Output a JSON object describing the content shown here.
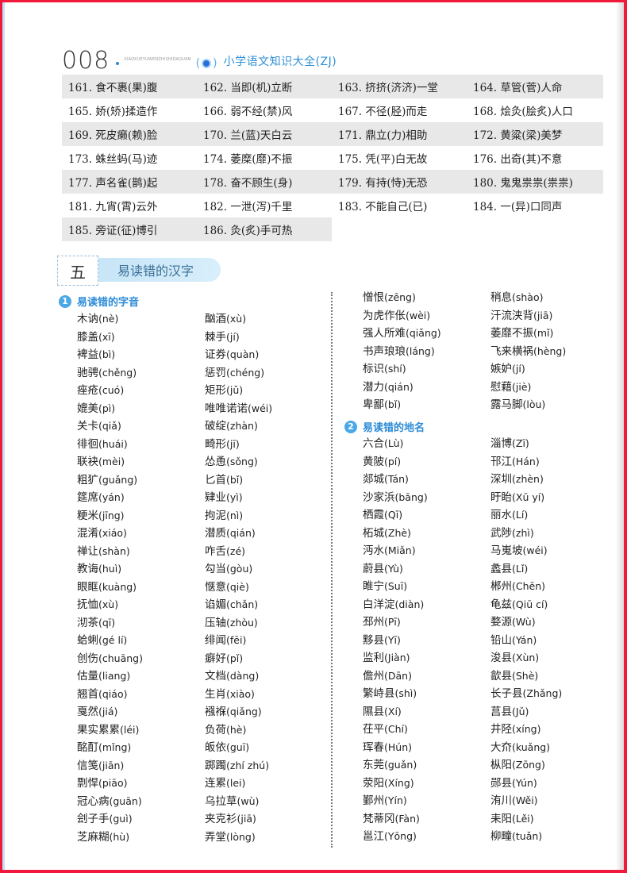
{
  "header": {
    "page_number": "008",
    "pinyin_caption": "XIAOXUEYUWENZHISHIDAQUAN",
    "book_title": "小学语文知识大全(ZJ)"
  },
  "idiom_corrections": [
    [
      "161. 食不裹(果)腹",
      "162. 当即(机)立断",
      "163. 挤挤(济济)一堂",
      "164. 草管(菅)人命"
    ],
    [
      "165. 娇(矫)揉造作",
      "166. 弱不经(禁)风",
      "167. 不径(胫)而走",
      "168. 烩灸(脍炙)人口"
    ],
    [
      "169. 死皮癞(赖)脸",
      "170. 兰(蓝)天白云",
      "171. 鼎立(力)相助",
      "172. 黄粱(梁)美梦"
    ],
    [
      "173. 蛛丝蚂(马)迹",
      "174. 萎糜(靡)不振",
      "175. 凭(平)白无故",
      "176. 出奇(其)不意"
    ],
    [
      "177. 声名雀(鹊)起",
      "178. 奋不顾生(身)",
      "179. 有持(恃)无恐",
      "180. 鬼鬼祟祟(祟祟)"
    ],
    [
      "181. 九宵(霄)云外",
      "182. 一泄(泻)千里",
      "183. 不能自己(已)",
      "184. 一(异)口同声"
    ],
    [
      "185. 旁证(征)博引",
      "186. 灸(炙)手可热"
    ]
  ],
  "section": {
    "number": "五",
    "title": "易读错的汉字"
  },
  "subsections": [
    {
      "number": "1",
      "title": "易读错的字音"
    },
    {
      "number": "2",
      "title": "易读错的地名"
    }
  ],
  "pronunciations": {
    "col1": [
      [
        "木讷",
        "(nè)"
      ],
      [
        "膝盖",
        "(xī)"
      ],
      [
        "裨益",
        "(bì)"
      ],
      [
        "驰骋",
        "(chěng)"
      ],
      [
        "痤疮",
        "(cuó)"
      ],
      [
        "媲美",
        "(pì)"
      ],
      [
        "关卡",
        "(qiǎ)"
      ],
      [
        "徘徊",
        "(huái)"
      ],
      [
        "联袂",
        "(mèi)"
      ],
      [
        "粗犷",
        "(guǎng)"
      ],
      [
        "筵席",
        "(yán)"
      ],
      [
        "粳米",
        "(jīng)"
      ],
      [
        "混淆",
        "(xiáo)"
      ],
      [
        "禅让",
        "(shàn)"
      ],
      [
        "教诲",
        "(huì)"
      ],
      [
        "眼眶",
        "(kuàng)"
      ],
      [
        "抚恤",
        "(xù)"
      ],
      [
        "沏茶",
        "(qī)"
      ],
      [
        "蛤蜊",
        "(gé lí)"
      ],
      [
        "创伤",
        "(chuāng)"
      ],
      [
        "估量",
        "(liang)"
      ],
      [
        "翘首",
        "(qiáo)"
      ],
      [
        "戛然",
        "(jiá)"
      ],
      [
        "果实累累",
        "(léi)"
      ],
      [
        "酩酊",
        "(mǐng)"
      ],
      [
        "信笺",
        "(jiān)"
      ],
      [
        "剽悍",
        "(piāo)"
      ],
      [
        "冠心病",
        "(guān)"
      ],
      [
        "刽子手",
        "(guì)"
      ],
      [
        "芝麻糊",
        "(hù)"
      ]
    ],
    "col2": [
      [
        "酗酒",
        "(xù)"
      ],
      [
        "棘手",
        "(jí)"
      ],
      [
        "证券",
        "(quàn)"
      ],
      [
        "惩罚",
        "(chéng)"
      ],
      [
        "矩形",
        "(jǔ)"
      ],
      [
        "唯唯诺诺",
        "(wéi)"
      ],
      [
        "破绽",
        "(zhàn)"
      ],
      [
        "畸形",
        "(jī)"
      ],
      [
        "怂恿",
        "(sǒng)"
      ],
      [
        "匕首",
        "(bǐ)"
      ],
      [
        "肄业",
        "(yì)"
      ],
      [
        "拘泥",
        "(nì)"
      ],
      [
        "潜质",
        "(qián)"
      ],
      [
        "咋舌",
        "(zé)"
      ],
      [
        "勾当",
        "(gòu)"
      ],
      [
        "惬意",
        "(qiè)"
      ],
      [
        "谄媚",
        "(chǎn)"
      ],
      [
        "压轴",
        "(zhòu)"
      ],
      [
        "绯闻",
        "(fēi)"
      ],
      [
        "癖好",
        "(pǐ)"
      ],
      [
        "文档",
        "(dàng)"
      ],
      [
        "生肖",
        "(xiào)"
      ],
      [
        "襁褓",
        "(qiǎng)"
      ],
      [
        "负荷",
        "(hè)"
      ],
      [
        "皈依",
        "(guī)"
      ],
      [
        "踯躅",
        "(zhí zhú)"
      ],
      [
        "连累",
        "(lei)"
      ],
      [
        "乌拉草",
        "(wù)"
      ],
      [
        "夹克衫",
        "(jiā)"
      ],
      [
        "弄堂",
        "(lòng)"
      ]
    ],
    "col3": [
      [
        "憎恨",
        "(zēng)"
      ],
      [
        "为虎作伥",
        "(wèi)"
      ],
      [
        "强人所难",
        "(qiǎng)"
      ],
      [
        "书声琅琅",
        "(láng)"
      ],
      [
        "标识",
        "(shí)"
      ],
      [
        "潜力",
        "(qián)"
      ],
      [
        "卑鄙",
        "(bǐ)"
      ]
    ],
    "col4": [
      [
        "稍息",
        "(shào)"
      ],
      [
        "汗流浃背",
        "(jiā)"
      ],
      [
        "萎靡不振",
        "(mǐ)"
      ],
      [
        "飞来横祸",
        "(hèng)"
      ],
      [
        "嫉妒",
        "(jí)"
      ],
      [
        "慰藉",
        "(jiè)"
      ],
      [
        "露马脚",
        "(lòu)"
      ]
    ]
  },
  "place_names": {
    "col3": [
      [
        "六合",
        "(Lù)"
      ],
      [
        "黄陂",
        "(pí)"
      ],
      [
        "郯城",
        "(Tán)"
      ],
      [
        "沙家浜",
        "(bāng)"
      ],
      [
        "栖霞",
        "(Qī)"
      ],
      [
        "柘城",
        "(Zhè)"
      ],
      [
        "沔水",
        "(Miǎn)"
      ],
      [
        "蔚县",
        "(Yù)"
      ],
      [
        "睢宁",
        "(Suī)"
      ],
      [
        "白洋淀",
        "(diàn)"
      ],
      [
        "邳州",
        "(Pī)"
      ],
      [
        "黟县",
        "(Yī)"
      ],
      [
        "监利",
        "(Jiàn)"
      ],
      [
        "儋州",
        "(Dān)"
      ],
      [
        "繁峙县",
        "(shì)"
      ],
      [
        "隰县",
        "(Xí)"
      ],
      [
        "茌平",
        "(Chí)"
      ],
      [
        "珲春",
        "(Hún)"
      ],
      [
        "东莞",
        "(guǎn)"
      ],
      [
        "荥阳",
        "(Xíng)"
      ],
      [
        "鄞州",
        "(Yín)"
      ],
      [
        "梵蒂冈",
        "(Fàn)"
      ],
      [
        "邕江",
        "(Yōng)"
      ]
    ],
    "col4": [
      [
        "淄博",
        "(Zī)"
      ],
      [
        "邗江",
        "(Hán)"
      ],
      [
        "深圳",
        "(zhèn)"
      ],
      [
        "盱眙",
        "(Xū yí)"
      ],
      [
        "丽水",
        "(Lí)"
      ],
      [
        "武陟",
        "(zhì)"
      ],
      [
        "马嵬坡",
        "(wéi)"
      ],
      [
        "蠡县",
        "(Lǐ)"
      ],
      [
        "郴州",
        "(Chēn)"
      ],
      [
        "龟兹",
        "(Qiū cí)"
      ],
      [
        "婺源",
        "(Wù)"
      ],
      [
        "铅山",
        "(Yán)"
      ],
      [
        "浚县",
        "(Xùn)"
      ],
      [
        "歙县",
        "(Shè)"
      ],
      [
        "长子县",
        "(Zhǎng)"
      ],
      [
        "莒县",
        "(Jǔ)"
      ],
      [
        "井陉",
        "(xíng)"
      ],
      [
        "大夼",
        "(kuǎng)"
      ],
      [
        "枞阳",
        "(Zōng)"
      ],
      [
        "郧县",
        "(Yún)"
      ],
      [
        "洧川",
        "(Wěi)"
      ],
      [
        "耒阳",
        "(Lěi)"
      ],
      [
        "柳疃",
        "(tuǎn)"
      ]
    ]
  },
  "colors": {
    "border": "#f0193c",
    "accent_blue": "#2a8ad6",
    "row_shade": "#e8e8e8"
  }
}
